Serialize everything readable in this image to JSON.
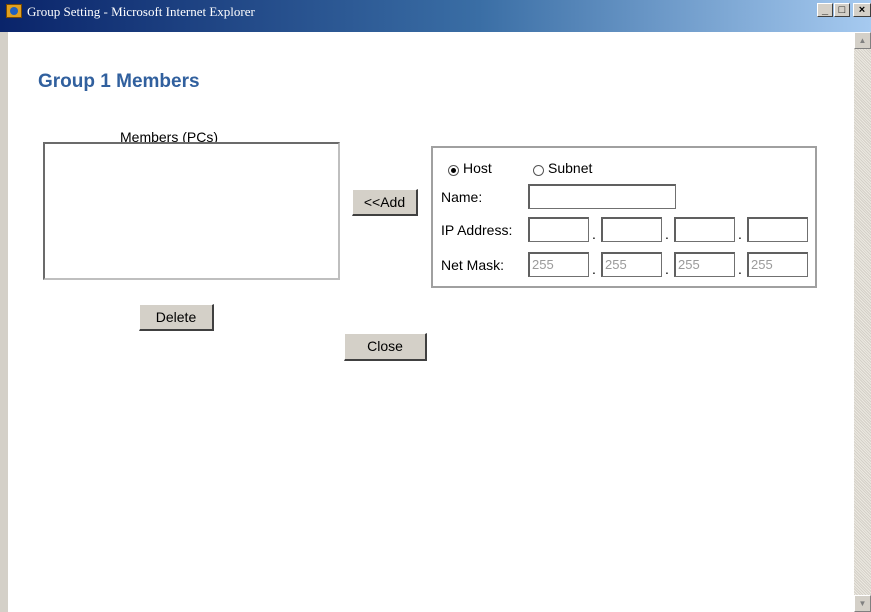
{
  "window": {
    "title": "Group Setting - Microsoft Internet Explorer",
    "controls": {
      "minimize": "_",
      "maximize": "□",
      "close": "×"
    }
  },
  "page": {
    "heading": "Group 1 Members",
    "members_label": "Members (PCs)",
    "members": [],
    "add_label": "<<Add",
    "delete_label": "Delete",
    "close_label": "Close"
  },
  "form": {
    "type_options": [
      {
        "label": "Host",
        "selected": true
      },
      {
        "label": "Subnet",
        "selected": false
      }
    ],
    "name_label": "Name:",
    "name_value": "",
    "ip_label": "IP Address:",
    "ip_octets": [
      "",
      "",
      "",
      ""
    ],
    "mask_label": "Net Mask:",
    "mask_octets": [
      "255",
      "255",
      "255",
      "255"
    ],
    "separator": "."
  },
  "colors": {
    "heading": "#31609e",
    "titlebar_start": "#0a246a",
    "titlebar_end": "#a6caf0"
  }
}
